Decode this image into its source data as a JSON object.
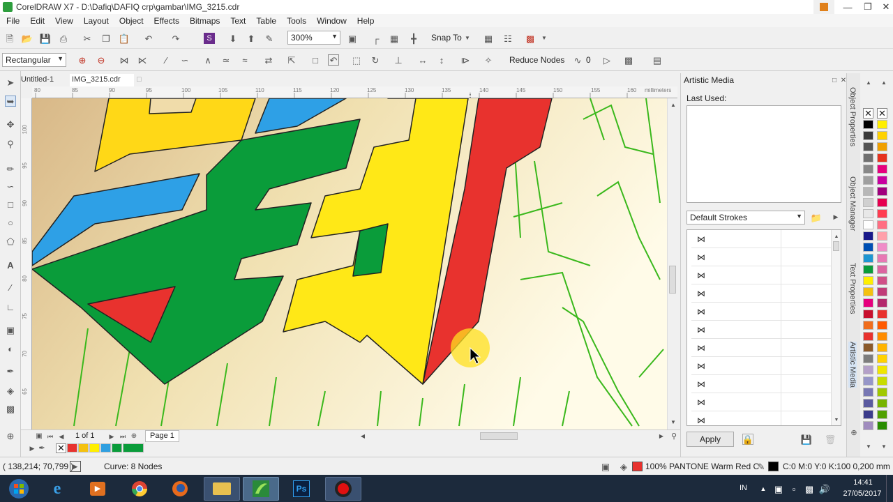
{
  "window": {
    "title": "CorelDRAW X7 - D:\\Dafiq\\DAFIQ crp\\gambar\\IMG_3215.cdr",
    "minimize_glyph": "—",
    "maximize_glyph": "❐",
    "close_glyph": "✕"
  },
  "menu": [
    "File",
    "Edit",
    "View",
    "Layout",
    "Object",
    "Effects",
    "Bitmaps",
    "Text",
    "Table",
    "Tools",
    "Window",
    "Help"
  ],
  "toolbar": {
    "zoom_value": "300%",
    "snap_to_label": "Snap To"
  },
  "property_bar": {
    "mode_value": "Rectangular",
    "reduce_nodes_label": "Reduce Nodes",
    "smoothing_value": "0"
  },
  "document_tabs": [
    "Untitled-1",
    "IMG_3215.cdr"
  ],
  "ruler": {
    "units": "millimeters",
    "h_labels": [
      "80",
      "85",
      "90",
      "95",
      "100",
      "105",
      "110",
      "115",
      "120",
      "125",
      "130",
      "135",
      "140",
      "145",
      "150",
      "155",
      "160"
    ],
    "v_labels": [
      "100",
      "95",
      "90",
      "85",
      "80",
      "75",
      "70",
      "65"
    ]
  },
  "page_nav": {
    "page_count": "1 of 1",
    "page_tab": "Page 1"
  },
  "document_palette": [
    "#e8322e",
    "#f4c10f",
    "#ffef00",
    "#2f9fe0",
    "#0a9c3a",
    "#0a9c3a"
  ],
  "status": {
    "coordinates": "( 138,214; 70,799 )",
    "selection_info": "Curve: 8 Nodes",
    "fill_info": "100% PANTONE Warm Red C",
    "outline_info": "C:0 M:0 Y:0 K:100  0,200 mm",
    "fill_color": "#e8322e"
  },
  "docker": {
    "title": "Artistic Media",
    "last_used_label": "Last Used:",
    "strokes_dropdown": "Default Strokes",
    "stroke_glyph": "⋈",
    "apply_label": "Apply",
    "side_tabs": [
      "Object Properties",
      "Object Manager",
      "Text Properties",
      "Artistic Media"
    ]
  },
  "color_palette": {
    "col1": [
      "#000000",
      "#3a3a3a",
      "#555555",
      "#707070",
      "#888888",
      "#a0a0a0",
      "#b8b8b8",
      "#d0d0d0",
      "#e8e8e8",
      "#ffffff",
      "#1a1a8a",
      "#0050b4",
      "#1e96d2",
      "#0a9c3a",
      "#ffef00",
      "#f4c10f",
      "#e6007e",
      "#c8102e",
      "#f06e1e",
      "#e8322e",
      "#8b5a2b",
      "#7d7d7d",
      "#b4a0c8",
      "#9696c8",
      "#7878b4",
      "#5a5aa0",
      "#3c3c8c",
      "#a08cbe"
    ],
    "col2": [
      "#ffef00",
      "#ffd200",
      "#f0a000",
      "#e6321e",
      "#e6007e",
      "#c800a0",
      "#a0007e",
      "#e60050",
      "#ff3c50",
      "#ff6e82",
      "#ffa0aa",
      "#f08cc8",
      "#e878b4",
      "#dc64a0",
      "#d05088",
      "#c03c78",
      "#b4286c",
      "#e8322e",
      "#ff5a00",
      "#ff8c00",
      "#ffb400",
      "#ffd200",
      "#f0e600",
      "#c8dc00",
      "#a0c800",
      "#78b400",
      "#50a000",
      "#288c00"
    ]
  },
  "taskbar": {
    "language": "IN",
    "time": "14:41",
    "date": "27/05/2017",
    "apps": [
      "start",
      "internet-explorer",
      "media-player",
      "chrome",
      "firefox",
      "file-explorer",
      "coreldraw",
      "photoshop",
      "recorder"
    ]
  }
}
